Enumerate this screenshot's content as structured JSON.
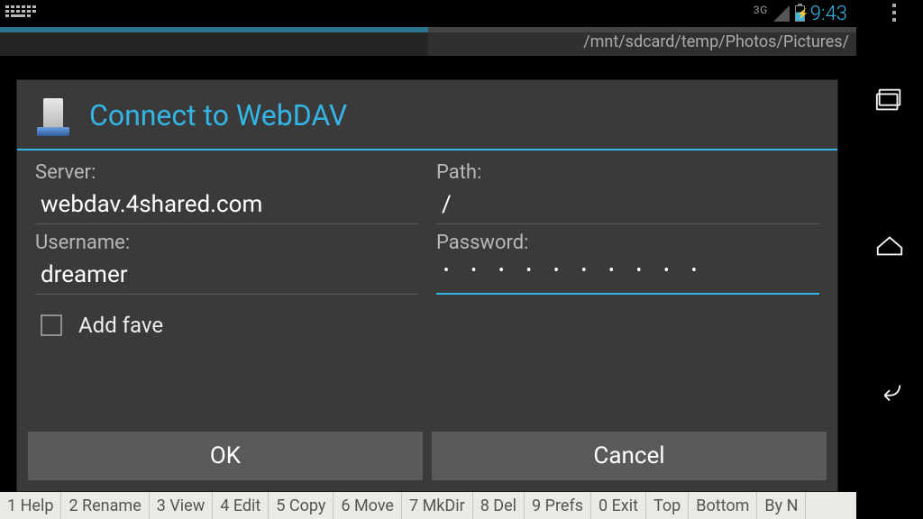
{
  "statusbar": {
    "network_label": "3G",
    "time": "9:43"
  },
  "tabs": {
    "left_path": "",
    "right_path": "/mnt/sdcard/temp/Photos/Pictures/"
  },
  "dialog": {
    "title": "Connect to WebDAV",
    "server_label": "Server:",
    "server_value": "webdav.4shared.com",
    "path_label": "Path:",
    "path_value": "/",
    "username_label": "Username:",
    "username_value": "dreamer",
    "password_label": "Password:",
    "password_masked": "• • • • • • • • • •",
    "add_fave_label": "Add fave",
    "add_fave_checked": false,
    "ok_label": "OK",
    "cancel_label": "Cancel"
  },
  "fnkeys": [
    "1 Help",
    "2 Rename",
    "3 View",
    "4 Edit",
    "5 Copy",
    "6 Move",
    "7 MkDir",
    "8 Del",
    "9 Prefs",
    "0 Exit",
    "Top",
    "Bottom",
    "By N"
  ]
}
